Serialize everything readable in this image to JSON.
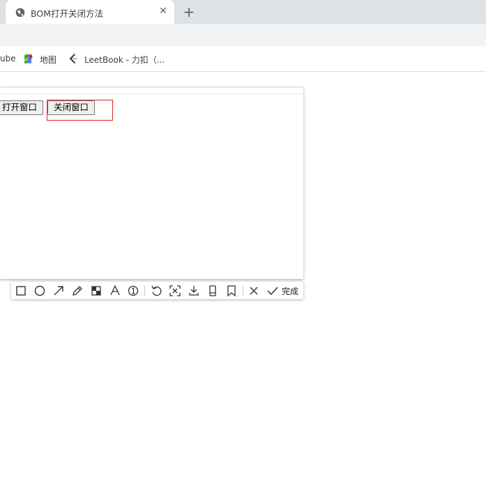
{
  "browser": {
    "tab_title": "BOM打开关闭方法",
    "close_glyph": "✕",
    "new_tab_glyph": "+"
  },
  "bookmarks": [
    {
      "label": "ube",
      "icon": "youtube-icon"
    },
    {
      "label": "地图",
      "icon": "maps-icon"
    },
    {
      "label": "LeetBook - 力扣（...",
      "icon": "leetcode-icon"
    }
  ],
  "page": {
    "open_button": "打开窗口",
    "close_button": "关闭窗口"
  },
  "screenshot_toolbar": {
    "done_label": "完成",
    "tools": [
      "rectangle-icon",
      "ellipse-icon",
      "arrow-icon",
      "pen-icon",
      "mosaic-icon",
      "text-icon",
      "number-icon",
      "undo-icon",
      "crop-icon",
      "download-icon",
      "pin-icon",
      "bookmark-icon",
      "close-icon",
      "confirm-icon"
    ],
    "accent": "#e0242a"
  }
}
